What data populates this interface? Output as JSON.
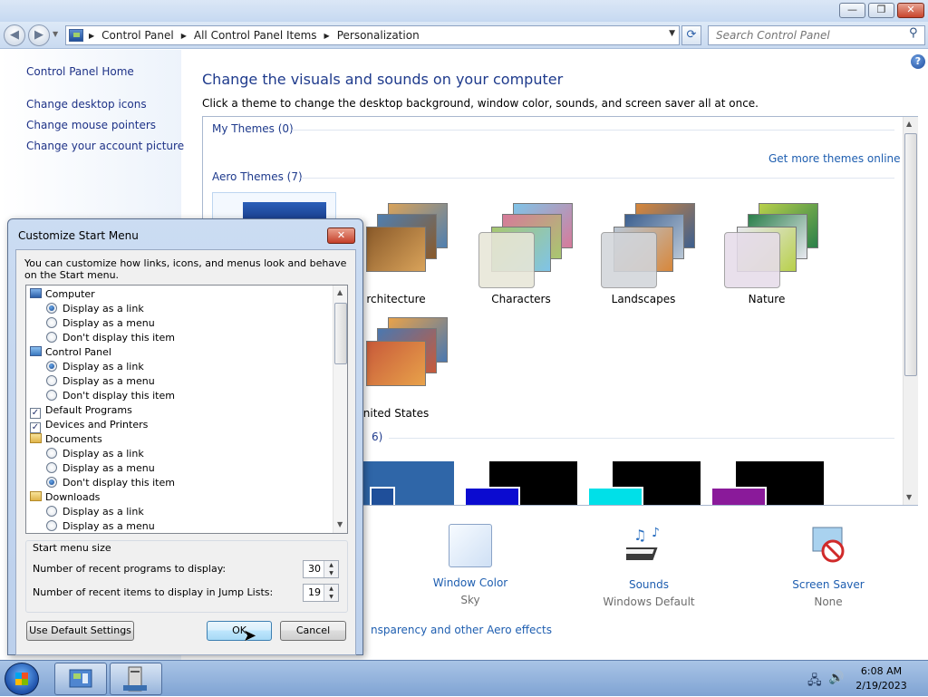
{
  "window": {
    "breadcrumb": [
      "Control Panel",
      "All Control Panel Items",
      "Personalization"
    ],
    "search_placeholder": "Search Control Panel"
  },
  "left_pane": {
    "home": "Control Panel Home",
    "links": [
      "Change desktop icons",
      "Change mouse pointers",
      "Change your account picture"
    ]
  },
  "main": {
    "title": "Change the visuals and sounds on your computer",
    "subtitle": "Click a theme to change the desktop background, window color, sounds, and screen saver all at once.",
    "my_themes_header": "My Themes (0)",
    "get_more": "Get more themes online",
    "aero_header": "Aero Themes (7)",
    "basic_header_partial": "6)",
    "themes": [
      {
        "name": "rchitecture",
        "colors": [
          "#d9a35a",
          "#4f7fb0",
          "#8a5a2a"
        ]
      },
      {
        "name": "Characters",
        "colors": [
          "#7fc4e8",
          "#d77a9a",
          "#a8c86f"
        ]
      },
      {
        "name": "Landscapes",
        "colors": [
          "#d8873a",
          "#3c5f8f",
          "#b9c7d6"
        ]
      },
      {
        "name": "Nature",
        "colors": [
          "#b8d04a",
          "#2a7f4a",
          "#e8e8f0"
        ]
      },
      {
        "name": "nited States",
        "colors": [
          "#e8a24a",
          "#4a78b0",
          "#c85a3a"
        ]
      }
    ],
    "basic_themes": [
      {
        "bg": "#2f66a8",
        "accent": "#1f4f9a"
      },
      {
        "bg": "#000000",
        "accent": "#0b0bd0"
      },
      {
        "bg": "#000000",
        "accent": "#00e0e8"
      },
      {
        "bg": "#000000",
        "accent": "#8a1a9a"
      }
    ],
    "window_color": {
      "label": "Window Color",
      "value": "Sky"
    },
    "sounds": {
      "label": "Sounds",
      "value": "Windows Default"
    },
    "screen_saver": {
      "label": "Screen Saver",
      "value": "None"
    },
    "aero_link_partial": "nsparency and other Aero effects"
  },
  "dialog": {
    "title": "Customize Start Menu",
    "description": "You can customize how links, icons, and menus look and behave on the Start menu.",
    "options": [
      {
        "type": "group",
        "label": "Computer",
        "icon": "computer-icon"
      },
      {
        "type": "radio",
        "label": "Display as a link",
        "checked": true
      },
      {
        "type": "radio",
        "label": "Display as a menu",
        "checked": false
      },
      {
        "type": "radio",
        "label": "Don't display this item",
        "checked": false
      },
      {
        "type": "group",
        "label": "Control Panel",
        "icon": "control-panel-icon"
      },
      {
        "type": "radio",
        "label": "Display as a link",
        "checked": true
      },
      {
        "type": "radio",
        "label": "Display as a menu",
        "checked": false
      },
      {
        "type": "radio",
        "label": "Don't display this item",
        "checked": false
      },
      {
        "type": "check",
        "label": "Default Programs",
        "checked": true
      },
      {
        "type": "check",
        "label": "Devices and Printers",
        "checked": true
      },
      {
        "type": "group",
        "label": "Documents",
        "icon": "folder-icon"
      },
      {
        "type": "radio",
        "label": "Display as a link",
        "checked": false
      },
      {
        "type": "radio",
        "label": "Display as a menu",
        "checked": false
      },
      {
        "type": "radio",
        "label": "Don't display this item",
        "checked": true
      },
      {
        "type": "group",
        "label": "Downloads",
        "icon": "folder-icon"
      },
      {
        "type": "radio",
        "label": "Display as a link",
        "checked": false
      },
      {
        "type": "radio",
        "label": "Display as a menu",
        "checked": false
      }
    ],
    "size_title": "Start menu size",
    "recent_programs_label": "Number of recent programs to display:",
    "recent_programs_value": "30",
    "recent_items_label": "Number of recent items to display in Jump Lists:",
    "recent_items_value": "19",
    "use_default": "Use Default Settings",
    "ok": "OK",
    "cancel": "Cancel"
  },
  "taskbar": {
    "time": "6:08 AM",
    "date": "2/19/2023"
  }
}
